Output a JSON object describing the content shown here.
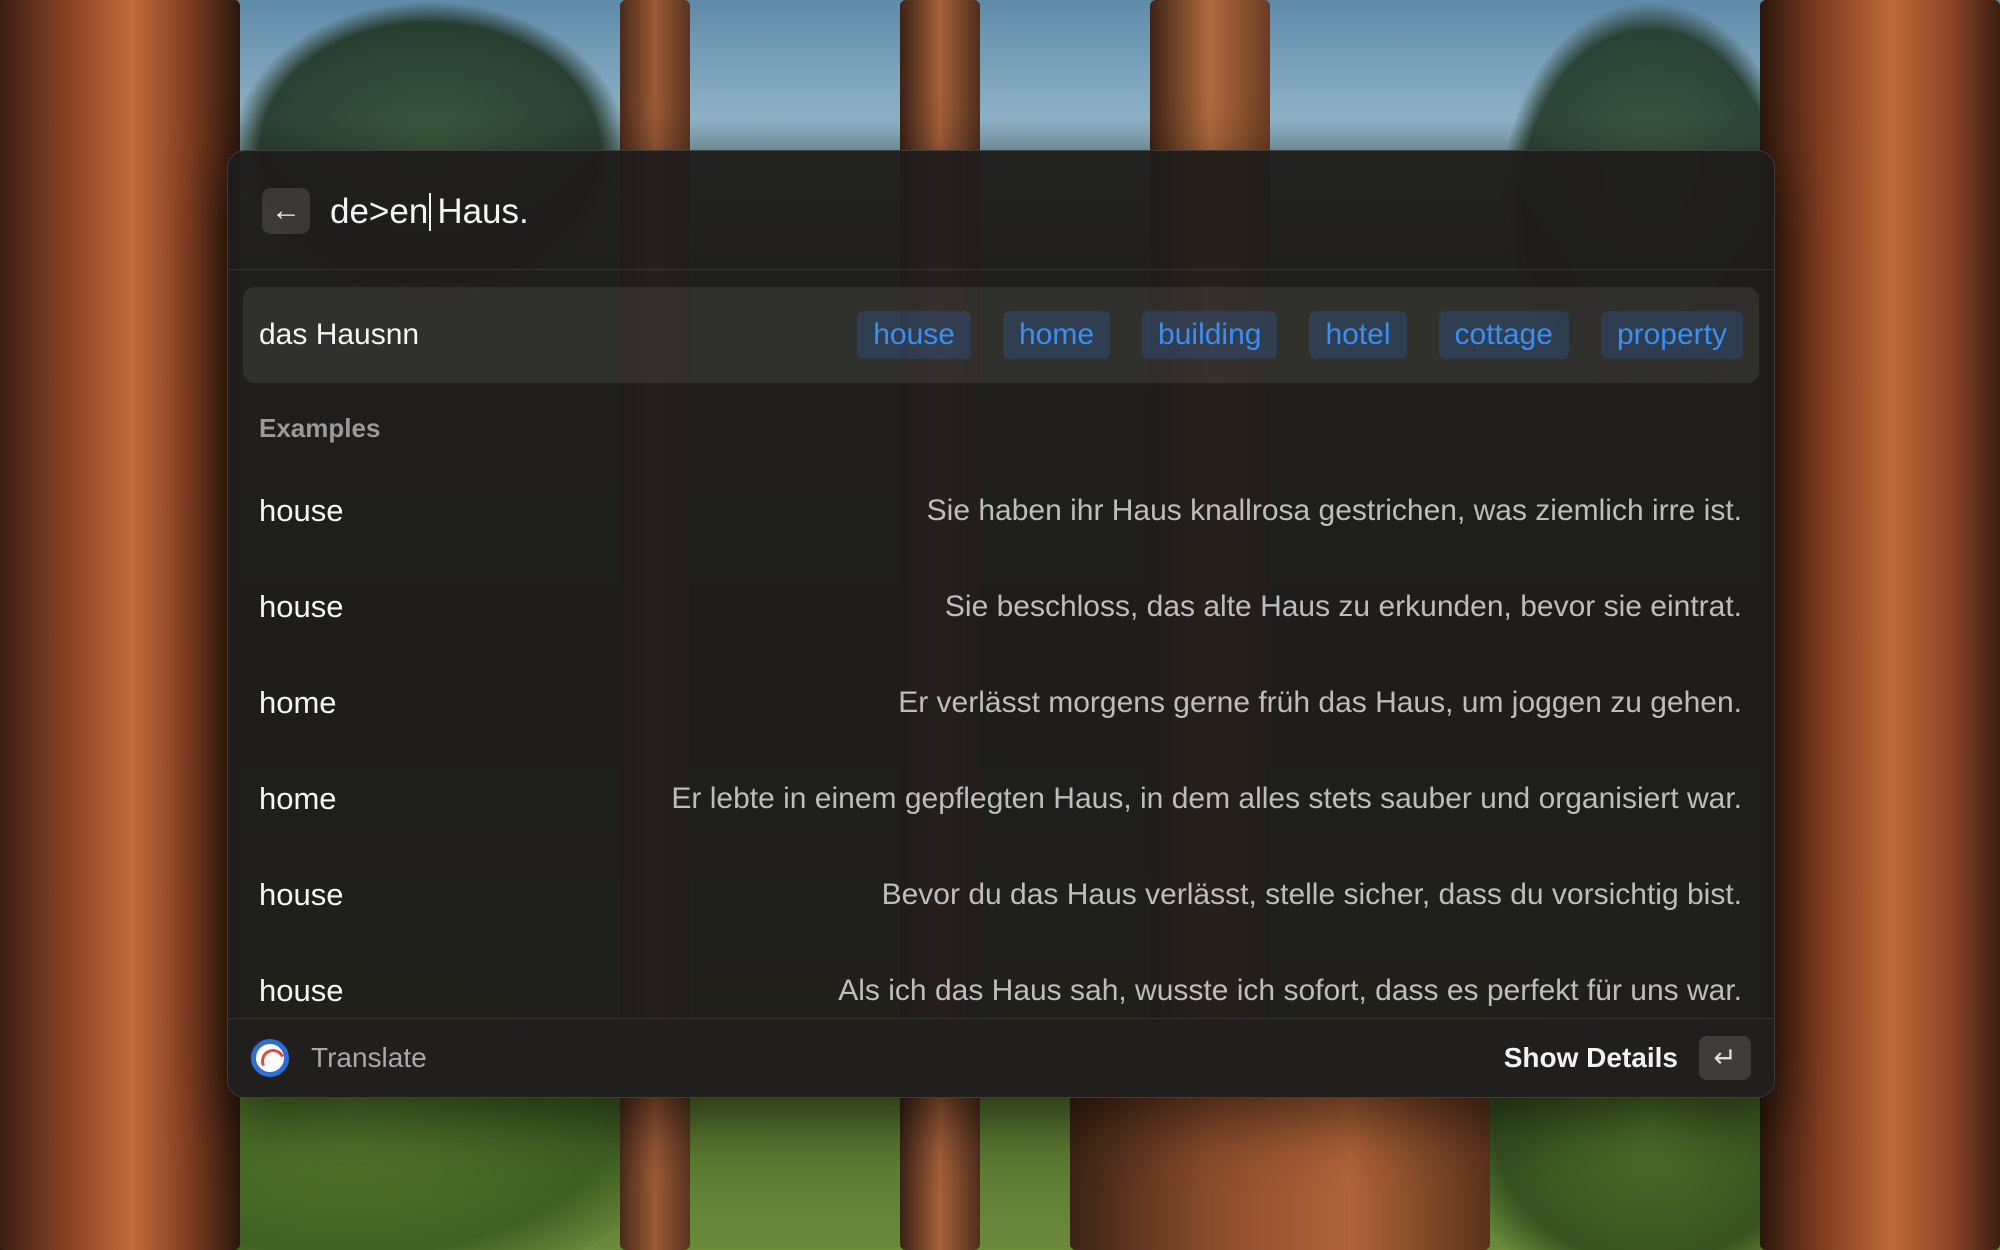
{
  "search": {
    "back_icon": "←",
    "query_before_caret": "de>en",
    "query_after_caret": "Haus."
  },
  "result": {
    "headword": "das Hausnn",
    "translations": [
      "house",
      "home",
      "building",
      "hotel",
      "cottage",
      "property"
    ]
  },
  "examples": {
    "label": "Examples",
    "items": [
      {
        "word": "house",
        "sentence": "Sie haben ihr Haus knallrosa gestrichen, was ziemlich irre ist."
      },
      {
        "word": "house",
        "sentence": "Sie beschloss, das alte Haus zu erkunden, bevor sie eintrat."
      },
      {
        "word": "home",
        "sentence": "Er verlässt morgens gerne früh das Haus, um joggen zu gehen."
      },
      {
        "word": "home",
        "sentence": "Er lebte in einem gepflegten Haus, in dem alles stets sauber und organisiert war."
      },
      {
        "word": "house",
        "sentence": "Bevor du das Haus verlässt, stelle sicher, dass du vorsichtig bist."
      },
      {
        "word": "house",
        "sentence": "Als ich das Haus sah, wusste ich sofort, dass es perfekt für uns war."
      }
    ]
  },
  "footer": {
    "app_icon": "translate-app-icon",
    "app_name": "Translate",
    "action_label": "Show Details",
    "enter_icon": "↵"
  },
  "colors": {
    "accent": "#3a8ff0",
    "panel_bg": "#1e1c1b"
  }
}
